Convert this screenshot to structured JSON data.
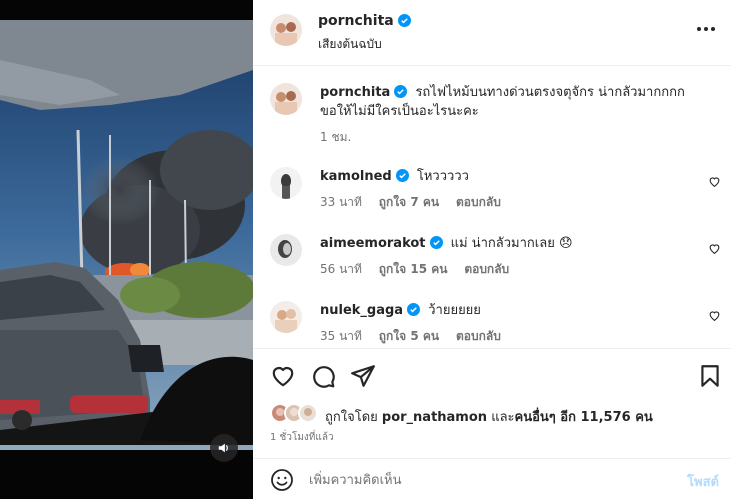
{
  "post": {
    "author": "pornchita",
    "audio": "เสียงต้นฉบับ"
  },
  "comments": [
    {
      "user": "pornchita",
      "text": "รถไฟไหม้บนทางด่วนตรงจตุจักร น่ากลัวมากกกก ขอให้ไม่มีใครเป็นอะไรนะคะ",
      "time": "1 ชม."
    },
    {
      "user": "kamolned",
      "text": "โหววววว",
      "time": "33 นาที",
      "likes": "ถูกใจ 7 คน",
      "reply": "ตอบกลับ"
    },
    {
      "user": "aimeemorakot",
      "text": "แม่ น่ากลัวมากเลย 😞",
      "time": "56 นาที",
      "likes": "ถูกใจ 15 คน",
      "reply": "ตอบกลับ"
    },
    {
      "user": "nulek_gaga",
      "text": "ว้ายยยยย",
      "time": "35 นาที",
      "likes": "ถูกใจ 5 คน",
      "reply": "ตอบกลับ"
    }
  ],
  "likes": {
    "prefix": "ถูกใจโดย",
    "user": "por_nathamon",
    "and": "และ",
    "others": "คนอื่นๆ อีก 11,576 คน"
  },
  "timeago": "1 ชั่วโมงที่แล้ว",
  "add_comment": {
    "placeholder": "เพิ่มความคิดเห็น",
    "post_label": "โพสต์"
  },
  "icons": {
    "verified": "verified-badge-icon",
    "more": "more-options-icon",
    "heart": "heart-icon",
    "comment": "comment-icon",
    "share": "share-icon",
    "save": "bookmark-icon",
    "emoji": "emoji-icon",
    "mute": "speaker-icon"
  },
  "colors": {
    "verified": "#0095f6",
    "post_disabled": "#b3dbff",
    "muted": "#737373"
  }
}
